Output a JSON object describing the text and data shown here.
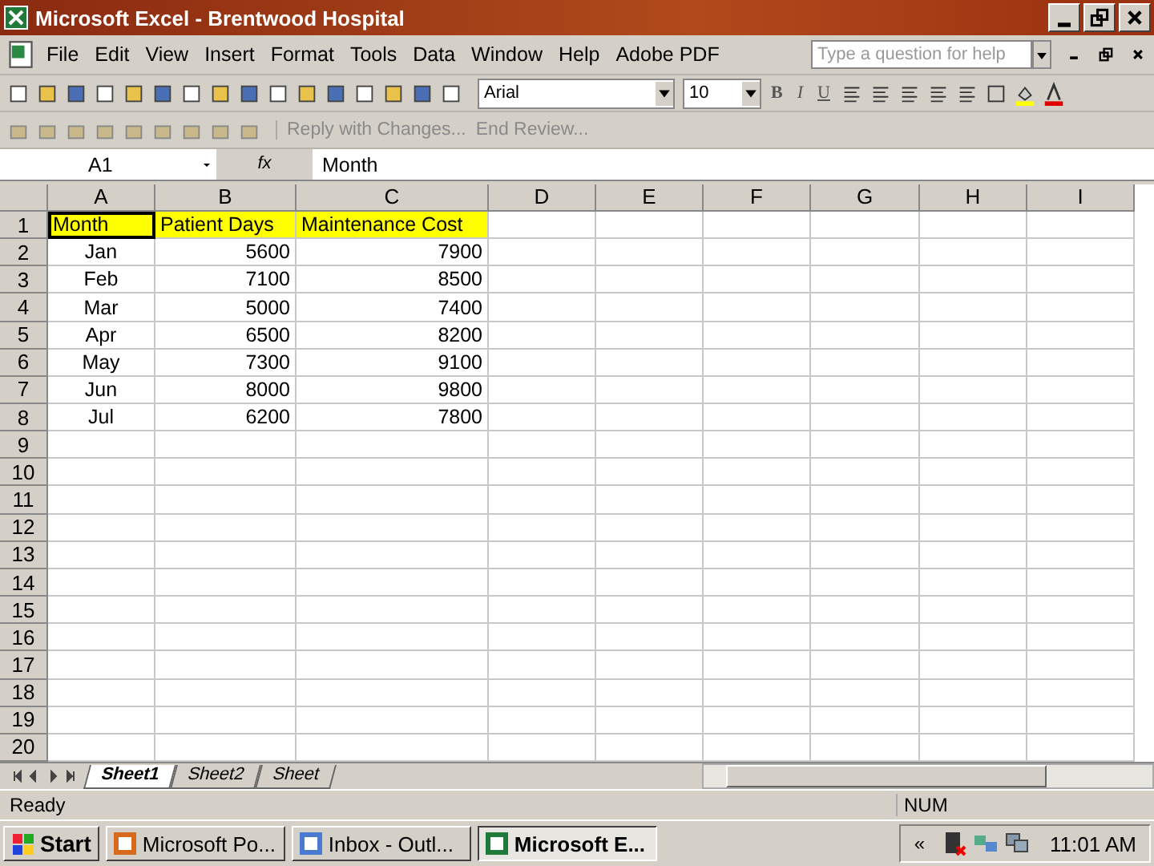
{
  "window": {
    "title": "Microsoft Excel - Brentwood Hospital"
  },
  "menu": [
    "File",
    "Edit",
    "View",
    "Insert",
    "Format",
    "Tools",
    "Data",
    "Window",
    "Help",
    "Adobe PDF"
  ],
  "help_box": {
    "placeholder": "Type a question for help"
  },
  "formatting": {
    "font": "Arial",
    "size": "10",
    "styles": [
      "B",
      "I",
      "U"
    ]
  },
  "review_toolbar": [
    "Reply with Changes...",
    "End Review..."
  ],
  "formula_bar": {
    "name_box": "A1",
    "fx": "fx",
    "value": "Month"
  },
  "columns": [
    "A",
    "B",
    "C",
    "D",
    "E",
    "F",
    "G",
    "H",
    "I"
  ],
  "rows": [
    {
      "number": "1",
      "kind": "header",
      "cells": [
        "Month",
        "Patient Days",
        "Maintenance Cost"
      ]
    },
    {
      "number": "2",
      "kind": "data",
      "cells": [
        "Jan",
        "5600",
        "7900"
      ]
    },
    {
      "number": "3",
      "kind": "data",
      "cells": [
        "Feb",
        "7100",
        "8500"
      ]
    },
    {
      "number": "4",
      "kind": "data",
      "cells": [
        "Mar",
        "5000",
        "7400"
      ]
    },
    {
      "number": "5",
      "kind": "data",
      "cells": [
        "Apr",
        "6500",
        "8200"
      ]
    },
    {
      "number": "6",
      "kind": "data",
      "cells": [
        "May",
        "7300",
        "9100"
      ]
    },
    {
      "number": "7",
      "kind": "data",
      "cells": [
        "Jun",
        "8000",
        "9800"
      ]
    },
    {
      "number": "8",
      "kind": "data",
      "cells": [
        "Jul",
        "6200",
        "7800"
      ]
    },
    {
      "number": "9",
      "kind": "empty"
    },
    {
      "number": "10",
      "kind": "empty"
    },
    {
      "number": "11",
      "kind": "empty"
    },
    {
      "number": "12",
      "kind": "empty"
    },
    {
      "number": "13",
      "kind": "empty"
    },
    {
      "number": "14",
      "kind": "empty"
    },
    {
      "number": "15",
      "kind": "empty"
    },
    {
      "number": "16",
      "kind": "empty"
    },
    {
      "number": "17",
      "kind": "empty"
    },
    {
      "number": "18",
      "kind": "empty"
    },
    {
      "number": "19",
      "kind": "empty"
    },
    {
      "number": "20",
      "kind": "empty"
    }
  ],
  "sheet_tabs": [
    {
      "label": "Sheet1",
      "selected": true
    },
    {
      "label": "Sheet2",
      "selected": false
    },
    {
      "label": "Sheet",
      "selected": false
    }
  ],
  "status_bar": {
    "state": "Ready",
    "num": "NUM"
  },
  "taskbar": {
    "start": "Start",
    "tasks": [
      {
        "label": "Microsoft Po...",
        "kind": "powerpoint",
        "selected": false
      },
      {
        "label": "Inbox - Outl...",
        "kind": "outlook",
        "selected": false
      },
      {
        "label": "Microsoft E...",
        "kind": "excel",
        "selected": true
      }
    ],
    "chevron": "«",
    "clock": "11:01 AM"
  }
}
